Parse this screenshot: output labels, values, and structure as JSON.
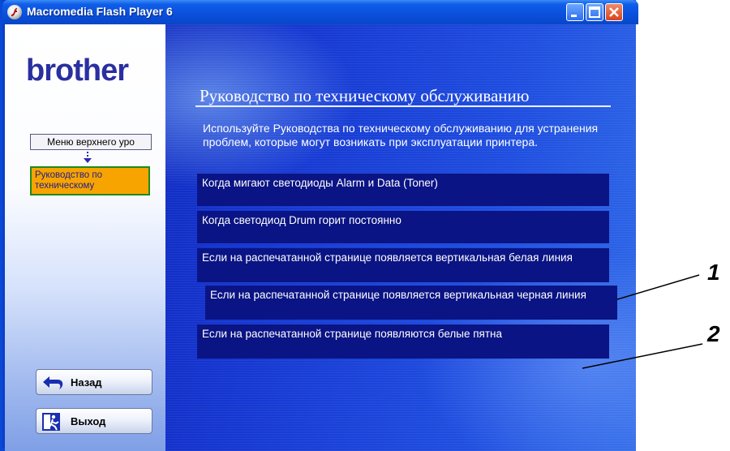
{
  "window": {
    "title": "Macromedia Flash Player 6"
  },
  "sidebar": {
    "logo": "brother",
    "nav_top": "Меню верхнего уро",
    "nav_current": "Руководство по техническому",
    "back_label": "Назад",
    "exit_label": "Выход"
  },
  "main": {
    "heading": "Руководство по техническому обслуживанию",
    "intro": "Используйте Руководства по техническому обслуживанию для устранения проблем, которые могут возникать при эксплуатации принтера.",
    "options": [
      "Когда мигают светодиоды Alarm и Data (Toner)",
      "Когда светодиод Drum горит постоянно",
      "Если на распечатанной странице появляется вертикальная белая линия",
      "Если на распечатанной странице появляется вертикальная черная линия",
      "Если на распечатанной странице появляются белые пятна"
    ]
  },
  "callouts": [
    "1",
    "2"
  ],
  "colors": {
    "title_bar": "#0a4fdc",
    "content_bg": "#1536d0",
    "option_bg": "#0a1484",
    "nav_current_bg": "#f8a400",
    "logo": "#2a2fa0"
  },
  "icons": [
    "flash-player-icon",
    "minimize-icon",
    "maximize-icon",
    "close-icon",
    "back-arrow-icon",
    "exit-door-icon",
    "down-arrow-icon"
  ]
}
